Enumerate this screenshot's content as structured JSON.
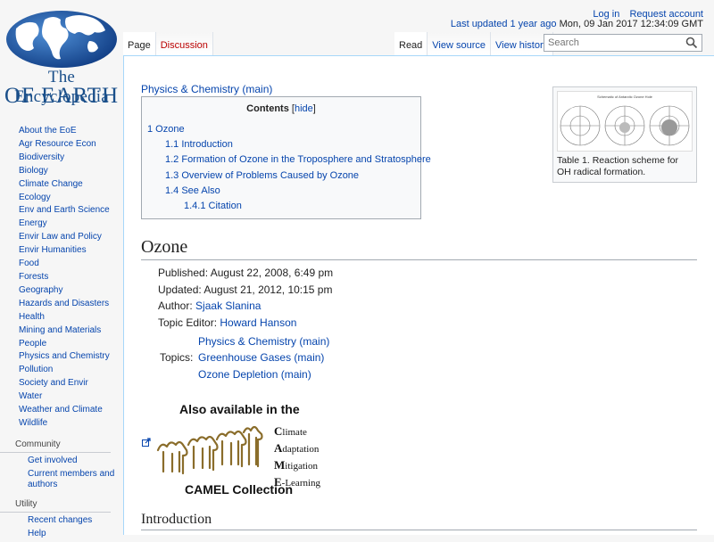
{
  "logo": {
    "line1": "The Encyclopedia",
    "line2": "OF EARTH"
  },
  "personal": {
    "login": "Log in",
    "request": "Request account"
  },
  "last_updated": {
    "link": "Last updated 1 year ago",
    "date": "Mon, 09 Jan 2017 12:34:09 GMT"
  },
  "tabs": {
    "page": "Page",
    "discussion": "Discussion",
    "read": "Read",
    "view_source": "View source",
    "view_history": "View history"
  },
  "search": {
    "placeholder": "Search"
  },
  "sidebar": {
    "items": [
      "About the EoE",
      "Agr Resource Econ",
      "Biodiversity",
      "Biology",
      "Climate Change",
      "Ecology",
      "Env and Earth Science",
      "Energy",
      "Envir Law and Policy",
      "Envir Humanities",
      "Food",
      "Forests",
      "Geography",
      "Hazards and Disasters",
      "Health",
      "Mining and Materials",
      "People",
      "Physics and Chemistry",
      "Pollution",
      "Society and Envir",
      "Water",
      "Weather and Climate",
      "Wildlife"
    ],
    "community": {
      "heading": "Community",
      "items": [
        "Get involved",
        "Current members and authors"
      ]
    },
    "utility": {
      "heading": "Utility",
      "items": [
        "Recent changes",
        "Help"
      ]
    }
  },
  "article": {
    "category": "Physics & Chemistry (main)",
    "toc": {
      "title": "Contents",
      "hide_open": "[",
      "hide": "hide",
      "hide_close": "]",
      "items": [
        "1 Ozone",
        "1.1 Introduction",
        "1.2 Formation of Ozone in the Troposphere and Stratosphere",
        "1.3 Overview of Problems Caused by Ozone",
        "1.4 See Also",
        "1.4.1 Citation"
      ]
    },
    "thumb": {
      "inner_title": "Schematic of Antarctic Ozone Hole",
      "caption": "Table 1. Reaction scheme for OH radical formation."
    },
    "heading": "Ozone",
    "published": "Published: August 22, 2008, 6:49 pm",
    "updated": "Updated: August 21, 2012, 10:15 pm",
    "author_label": "Author:",
    "author": "Sjaak Slanina",
    "editor_label": "Topic Editor:",
    "editor": "Howard Hanson",
    "topics_label": "Topics:",
    "topics": [
      "Physics & Chemistry (main)",
      "Greenhouse Gases (main)",
      "Ozone Depletion (main)"
    ],
    "camel": {
      "line1": "Also available in the",
      "c": "C",
      "c_rest": "limate",
      "a": "A",
      "a_rest": "daptation",
      "m": "M",
      "m_rest": "itigation",
      "e": "E",
      "e_rest": "-Learning",
      "collection": "CAMEL Collection"
    },
    "intro_heading": "Introduction"
  }
}
